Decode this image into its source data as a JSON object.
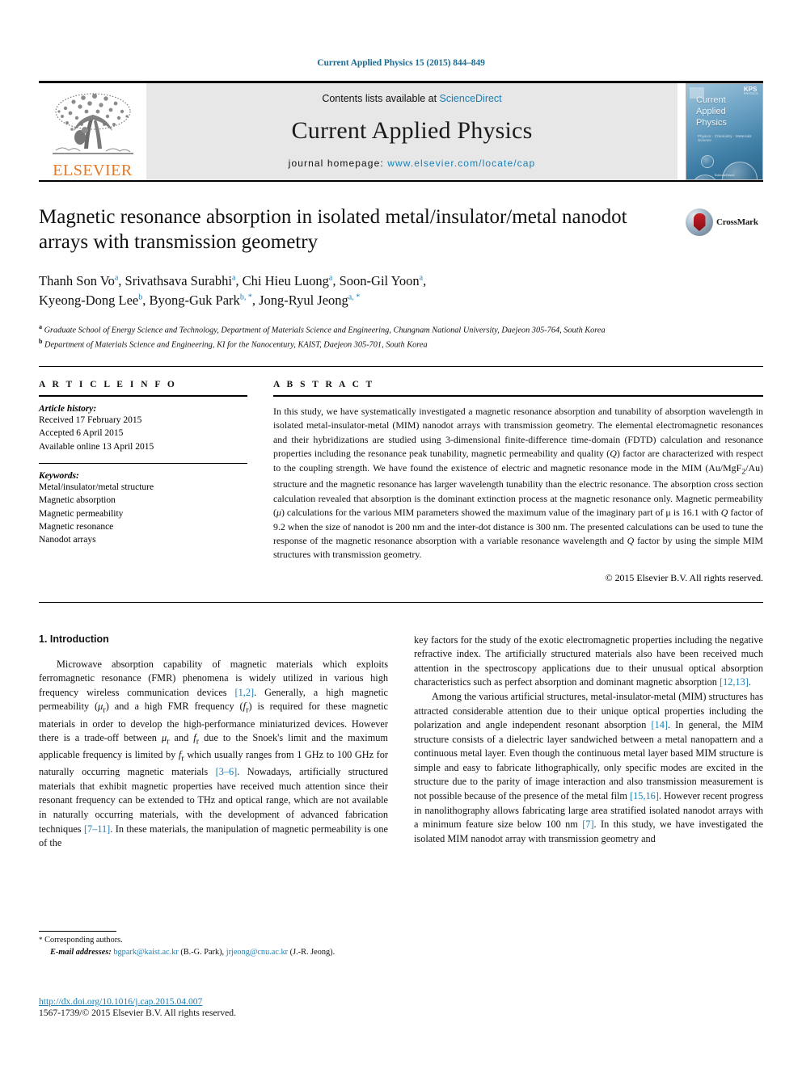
{
  "running_head": "Current Applied Physics 15 (2015) 844–849",
  "masthead": {
    "contents_prefix": "Contents lists available at ",
    "sciencedirect": "ScienceDirect",
    "journal_title": "Current Applied Physics",
    "homepage_prefix": "journal homepage: ",
    "homepage_url": "www.elsevier.com/locate/cap",
    "publisher": "ELSEVIER",
    "publisher_color": "#E87722",
    "link_color": "#1a7fb5",
    "cover": {
      "line1": "Current",
      "line2": "Applied",
      "line3": "Physics",
      "society": "KPS",
      "society_sub": "PHYSICS",
      "subtitle": "Physics · Chemistry · Materials Science",
      "publisher_foot": "ScienceDirect"
    }
  },
  "article": {
    "title": "Magnetic resonance absorption in isolated metal/insulator/metal nanodot arrays with transmission geometry",
    "crossmark_label": "CrossMark",
    "authors_line1": "Thanh Son Vo ᵃ, Srivathsava Surabhi ᵃ, Chi Hieu Luong ᵃ, Soon-Gil Yoon ᵃ,",
    "authors_line2": "Kyeong-Dong Lee ᵇ, Byong-Guk Park ᵇ, *, Jong-Ryul Jeong ᵃ, *",
    "authors": [
      {
        "name": "Thanh Son Vo",
        "sup": "a"
      },
      {
        "name": "Srivathsava Surabhi",
        "sup": "a"
      },
      {
        "name": "Chi Hieu Luong",
        "sup": "a"
      },
      {
        "name": "Soon-Gil Yoon",
        "sup": "a"
      },
      {
        "name": "Kyeong-Dong Lee",
        "sup": "b"
      },
      {
        "name": "Byong-Guk Park",
        "sup": "b, *"
      },
      {
        "name": "Jong-Ryul Jeong",
        "sup": "a, *"
      }
    ],
    "affiliation_a": "Graduate School of Energy Science and Technology, Department of Materials Science and Engineering, Chungnam National University, Daejeon 305-764, South Korea",
    "affiliation_b": "Department of Materials Science and Engineering, KI for the Nanocentury, KAIST, Daejeon 305-701, South Korea"
  },
  "article_info": {
    "heading": "A R T I C L E  I N F O",
    "history_label": "Article history:",
    "history": [
      "Received 17 February 2015",
      "Accepted 6 April 2015",
      "Available online 13 April 2015"
    ],
    "keywords_label": "Keywords:",
    "keywords": [
      "Metal/insulator/metal structure",
      "Magnetic absorption",
      "Magnetic permeability",
      "Magnetic resonance",
      "Nanodot arrays"
    ]
  },
  "abstract": {
    "heading": "A B S T R A C T",
    "text": "In this study, we have systematically investigated a magnetic resonance absorption and tunability of absorption wavelength in isolated metal-insulator-metal (MIM) nanodot arrays with transmission geometry. The elemental electromagnetic resonances and their hybridizations are studied using 3-dimensional finite-difference time-domain (FDTD) calculation and resonance properties including the resonance peak tunability, magnetic permeability and quality (Q) factor are characterized with respect to the coupling strength. We have found the existence of electric and magnetic resonance mode in the MIM (Au/MgF2/Au) structure and the magnetic resonance has larger wavelength tunability than the electric resonance. The absorption cross section calculation revealed that absorption is the dominant extinction process at the magnetic resonance only. Magnetic permeability (μ) calculations for the various MIM parameters showed the maximum value of the imaginary part of μ is 16.1 with Q factor of 9.2 when the size of nanodot is 200 nm and the inter-dot distance is 300 nm. The presented calculations can be used to tune the response of the magnetic resonance absorption with a variable resonance wavelength and Q factor by using the simple MIM structures with transmission geometry.",
    "copyright": "© 2015 Elsevier B.V. All rights reserved."
  },
  "body": {
    "section_heading": "1. Introduction",
    "left_paragraph_1": "Microwave absorption capability of magnetic materials which exploits ferromagnetic resonance (FMR) phenomena is widely utilized in various high frequency wireless communication devices [1,2]. Generally, a high magnetic permeability (μr) and a high FMR frequency (fr) is required for these magnetic materials in order to develop the high-performance miniaturized devices. However there is a trade-off between μr and fr due to the Snoek's limit and the maximum applicable frequency is limited by fr which usually ranges from 1 GHz to 100 GHz for naturally occurring magnetic materials [3–6]. Nowadays, artificially structured materials that exhibit magnetic properties have received much attention since their resonant frequency can be extended to THz and optical range, which are not available in naturally occurring materials, with the development of advanced fabrication techniques [7–11]. In these materials, the manipulation of magnetic permeability is one of the",
    "right_paragraph_1": "key factors for the study of the exotic electromagnetic properties including the negative refractive index. The artificially structured materials also have been received much attention in the spectroscopy applications due to their unusual optical absorption characteristics such as perfect absorption and dominant magnetic absorption [12,13].",
    "right_paragraph_2": "Among the various artificial structures, metal-insulator-metal (MIM) structures has attracted considerable attention due to their unique optical properties including the polarization and angle independent resonant absorption [14]. In general, the MIM structure consists of a dielectric layer sandwiched between a metal nanopattern and a continuous metal layer. Even though the continuous metal layer based MIM structure is simple and easy to fabricate lithographically, only specific modes are excited in the structure due to the parity of image interaction and also transmission measurement is not possible because of the presence of the metal film [15,16]. However recent progress in nanolithography allows fabricating large area stratified isolated nanodot arrays with a minimum feature size below 100 nm [7]. In this study, we have investigated the isolated MIM nanodot array with transmission geometry and"
  },
  "footnote": {
    "star": "*",
    "corresponding": "Corresponding authors.",
    "email_label": "E-mail addresses:",
    "email_1": "bgpark@kaist.ac.kr",
    "email_1_owner": "(B.-G. Park)",
    "email_2": "jrjeong@cnu.ac.kr",
    "email_2_owner": "(J.-R. Jeong)."
  },
  "doi": {
    "url": "http://dx.doi.org/10.1016/j.cap.2015.04.007",
    "issn_line": "1567-1739/© 2015 Elsevier B.V. All rights reserved."
  }
}
